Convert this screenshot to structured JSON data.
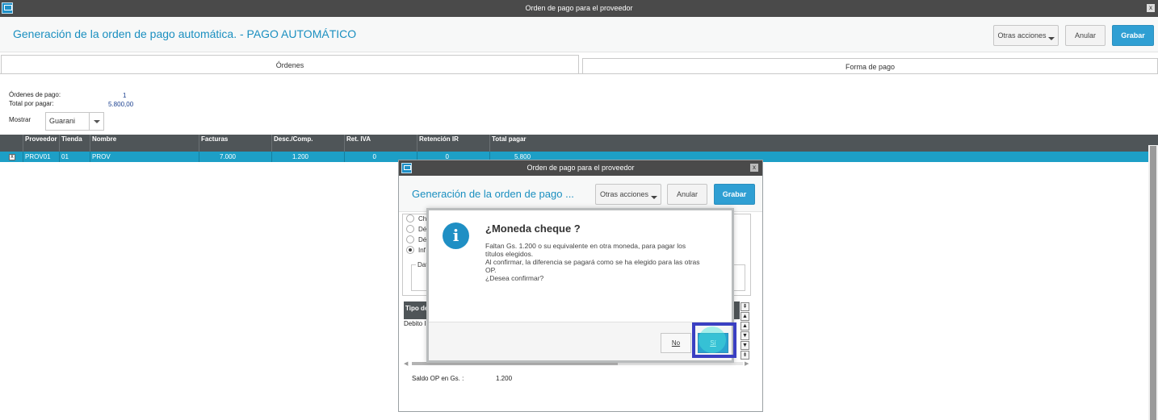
{
  "window": {
    "title": "Orden de pago para el proveedor",
    "close_label": "x"
  },
  "header": {
    "title": "Generación de la orden de pago automática. - PAGO AUTOMÁTICO",
    "other_actions": "Otras acciones",
    "cancel": "Anular",
    "save": "Grabar"
  },
  "tabs": [
    {
      "label": "Órdenes",
      "active": true
    },
    {
      "label": "Forma de pago",
      "active": false
    }
  ],
  "summary": {
    "orders_label": "Órdenes de pago:",
    "orders_value": "1",
    "total_label": "Total por pagar:",
    "total_value": "5.800,00",
    "show_label": "Mostrar",
    "show_value": "Guarani"
  },
  "grid": {
    "columns": [
      "Proveedor",
      "Tienda",
      "Nombre",
      "Facturas",
      "Desc./Comp.",
      "Ret. IVA",
      "Retención IR",
      "Total pagar"
    ],
    "rows": [
      {
        "checked": true,
        "check_glyph": "x",
        "proveedor": "PROV01",
        "tienda": "01",
        "nombre": "PROV",
        "facturas": "7.000",
        "desc": "1.200",
        "ret_iva": "0",
        "ret_ir": "0",
        "total": "5.800"
      }
    ]
  },
  "subwindow": {
    "title": "Orden de pago para el proveedor",
    "close_label": "x",
    "header_title": "Generación de la orden de pago ...",
    "other_actions": "Otras acciones",
    "cancel": "Anular",
    "save": "Grabar",
    "radios": [
      {
        "label": "Ch",
        "checked": false
      },
      {
        "label": "Dé",
        "checked": false
      },
      {
        "label": "Dé",
        "checked": false
      },
      {
        "label": "Inf",
        "checked": true
      }
    ],
    "group_label": "Dat",
    "mini_grid_header": "Tipo de",
    "mini_grid_row": "Debito I",
    "side_buttons": [
      "⇞",
      "▲",
      "▲",
      "▼",
      "▼",
      "⇟"
    ],
    "saldo_label": "Saldo OP en Gs. :",
    "saldo_value": "1.200"
  },
  "dialog": {
    "icon_glyph": "i",
    "title": "¿Moneda cheque    ?",
    "message_lines": [
      "Faltan Gs. 1.200 o su equivalente en otra moneda, para pagar los",
      "títulos elegidos.",
      "Al confirmar, la diferencia se pagará como se ha elegido para las otras",
      "OP.",
      "¿Desea confirmar?"
    ],
    "no_label": "No",
    "yes_label": "Sí"
  },
  "colors": {
    "accent": "#2f9fd3",
    "titlebar": "#4a4a4a",
    "grid_header": "#4f5558",
    "selected_row": "#1d9fc6",
    "highlight_box": "#3a3fc2"
  }
}
